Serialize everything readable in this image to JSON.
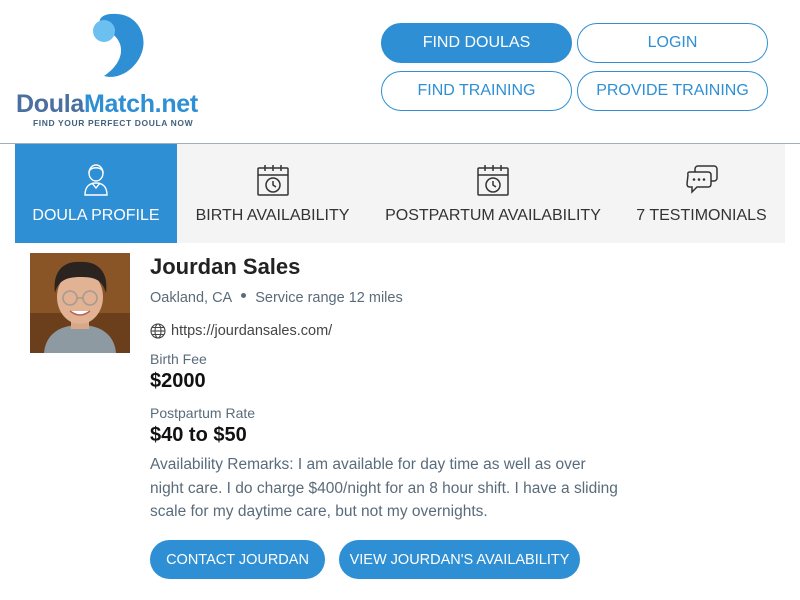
{
  "logo": {
    "part1": "Doula",
    "part2": "Match.net",
    "tagline": "FIND YOUR PERFECT DOULA NOW"
  },
  "nav": {
    "find_doulas": "FIND DOULAS",
    "login": "LOGIN",
    "find_training": "FIND TRAINING",
    "provide_training": "PROVIDE TRAINING"
  },
  "tabs": [
    {
      "label": "DOULA PROFILE",
      "icon": "doula-profile-icon",
      "active": true
    },
    {
      "label": "BIRTH AVAILABILITY",
      "icon": "calendar-clock-icon",
      "active": false
    },
    {
      "label": "POSTPARTUM AVAILABILITY",
      "icon": "calendar-clock-icon",
      "active": false
    },
    {
      "label": "7 TESTIMONIALS",
      "icon": "chat-bubbles-icon",
      "active": false
    }
  ],
  "profile": {
    "name": "Jourdan Sales",
    "city": "Oakland, CA",
    "service_range": "Service range 12 miles",
    "website": "https://jourdansales.com/",
    "birth_fee_label": "Birth Fee",
    "birth_fee": "$2000",
    "postpartum_label": "Postpartum Rate",
    "postpartum_rate": "$40 to $50",
    "remarks": "Availability Remarks: I am available for day time as well as over night care. I do charge $400/night for an 8 hour shift. I have a sliding scale for my daytime care, but not my overnights."
  },
  "actions": {
    "contact": "CONTACT JOURDAN",
    "view_availability": "VIEW JOURDAN'S AVAILABILITY"
  },
  "colors": {
    "accent": "#2e8fd4",
    "tab_bg": "#f4f4f4",
    "muted_text": "#5a6b7a"
  }
}
